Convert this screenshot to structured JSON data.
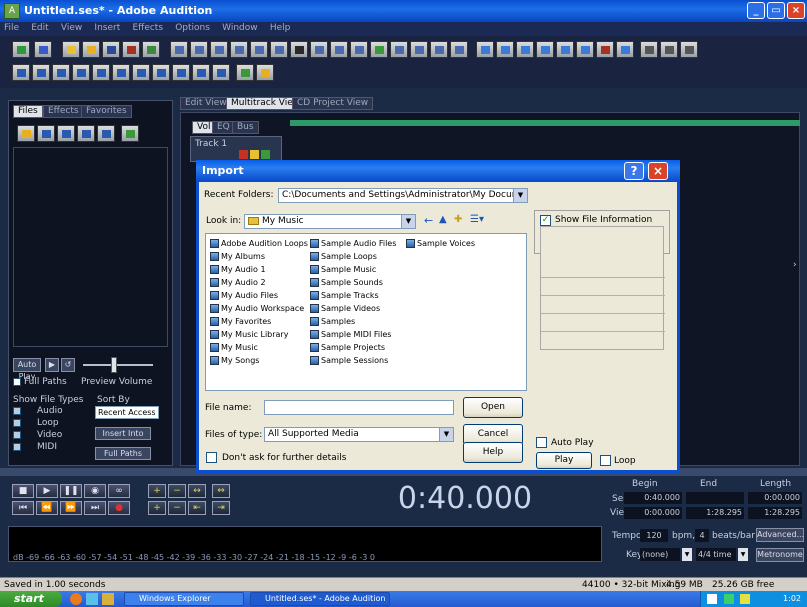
{
  "window": {
    "title": "Untitled.ses* - Adobe Audition",
    "menu": [
      "File",
      "Edit",
      "View",
      "Insert",
      "Effects",
      "Options",
      "Window",
      "Help"
    ]
  },
  "left_panel": {
    "tabs": [
      "Files",
      "Effects",
      "Favorites"
    ],
    "auto_play_label": "Auto Play",
    "full_path_label": "Full Paths",
    "preview_volume_label": "Preview Volume",
    "show_file_types_label": "Show File Types",
    "sort_by_label": "Sort By",
    "file_types": [
      "Audio",
      "Loop",
      "Video",
      "MIDI"
    ],
    "sort_select": "Recent Access",
    "insert_btn": "Insert Into",
    "close_btn": "Full Paths"
  },
  "main_tabs": [
    "Edit View",
    "Multitrack View",
    "CD Project View"
  ],
  "track_tabs": [
    "Vol",
    "EQ",
    "Bus"
  ],
  "track_name": "Track 1",
  "dialog": {
    "title": "Import",
    "recent_folders_label": "Recent Folders:",
    "recent_folders_value": "C:\\Documents and Settings\\Administrator\\My Documents\\My Music",
    "look_in_label": "Look in:",
    "look_in_value": "My Music",
    "show_file_info_label": "Show File Information",
    "file_name_label": "File name:",
    "files_of_type_label": "Files of type:",
    "files_of_type_value": "All Supported Media",
    "open_btn": "Open",
    "cancel_btn": "Cancel",
    "help_btn": "Help",
    "auto_play_label": "Auto Play",
    "play_btn": "Play",
    "loop_label": "Loop",
    "dont_ask_label": "Don't ask for further details",
    "files_col1": [
      "Adobe Audition Loops",
      "My Albums",
      "My Audio 1",
      "My Audio 2",
      "My Audio Files",
      "My Audio Workspace",
      "My Favorites",
      "My Music Library",
      "My Music",
      "My Songs"
    ],
    "files_col2": [
      "Sample Audio Files",
      "Sample Loops",
      "Sample Music",
      "Sample Sounds",
      "Sample Tracks",
      "Sample Videos",
      "Samples",
      "Sample MIDI Files",
      "Sample Projects",
      "Sample Sessions"
    ],
    "files_col3": [
      "Sample Voices"
    ]
  },
  "time": {
    "display": "0:40.000",
    "begin_label": "Begin",
    "end_label": "End",
    "length_label": "Length",
    "sel_label": "Sel",
    "view_label": "View",
    "sel_begin": "0:40.000",
    "sel_end": "",
    "sel_length": "0:00.000",
    "view_begin": "0:00.000",
    "view_end": "1:28.295",
    "view_length": "1:28.295"
  },
  "tempo": {
    "label": "Tempo",
    "value": "120",
    "bpm_label": "bpm,",
    "beats": "4",
    "beats_label": "beats/bar",
    "advanced_btn": "Advanced...",
    "key_label": "Key",
    "key_value": "(none)",
    "time_sig": "4/4 time",
    "metronome_btn": "Metronome"
  },
  "status": {
    "left": "Saved in 1.00 seconds",
    "format": "44100 • 32-bit Mixing",
    "size": "4.59 MB",
    "free": "25.26 GB free"
  },
  "taskbar": {
    "start": "start",
    "items": [
      "Windows Explorer",
      "Untitled.ses* - Adobe Audition"
    ],
    "clock": "1:02"
  },
  "colors": {
    "xp_blue": "#0a4fd0",
    "workspace": "#1b2a45",
    "time_text": "#c8d4e8",
    "selection_range": "#2e9a68"
  }
}
